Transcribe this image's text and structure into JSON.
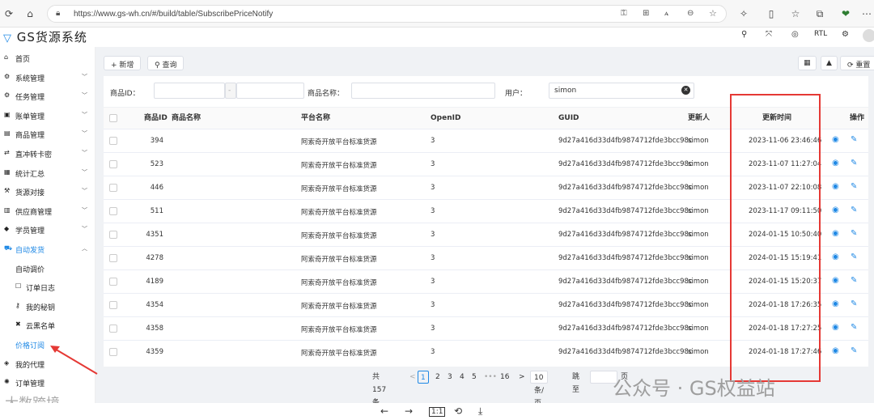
{
  "browser": {
    "url": "https://www.gs-wh.cn/#/build/table/SubscribePriceNotify"
  },
  "app": {
    "logo_text": "GS货源系统",
    "rtl_label": "RTL"
  },
  "sidebar": {
    "items": [
      {
        "label": "首页",
        "icon": "home-icon",
        "glyph": "⌂"
      },
      {
        "label": "系统管理",
        "icon": "gears-icon",
        "glyph": "⚙"
      },
      {
        "label": "任务管理",
        "icon": "gear-icon",
        "glyph": "⚙"
      },
      {
        "label": "账单管理",
        "icon": "money-icon",
        "glyph": "▣"
      },
      {
        "label": "商品管理",
        "icon": "box-icon",
        "glyph": "▤"
      },
      {
        "label": "直冲转卡密",
        "icon": "shuffle-icon",
        "glyph": "⇄"
      },
      {
        "label": "统计汇总",
        "icon": "chart-icon",
        "glyph": "▦"
      },
      {
        "label": "货源对接",
        "icon": "hammer-icon",
        "glyph": "⚒"
      },
      {
        "label": "供应商管理",
        "icon": "store-icon",
        "glyph": "▥"
      },
      {
        "label": "学员管理",
        "icon": "graduation-icon",
        "glyph": "◆"
      },
      {
        "label": "自动发货",
        "icon": "car-icon",
        "glyph": "⛟"
      }
    ],
    "subitems": [
      {
        "label": "自动调价",
        "glyph": ""
      },
      {
        "label": "订单日志",
        "glyph": "☐"
      },
      {
        "label": "我的秘钥",
        "glyph": "⚷"
      },
      {
        "label": "云黑名单",
        "glyph": "✖"
      },
      {
        "label": "价格订阅",
        "glyph": ""
      }
    ],
    "bottom_items": [
      {
        "label": "我的代理",
        "glyph": "◈"
      },
      {
        "label": "订单管理",
        "glyph": "✺"
      }
    ]
  },
  "toolbar": {
    "add_label": "新增",
    "search_label": "查询",
    "reset_label": "重置"
  },
  "filters": {
    "product_id_label": "商品ID：",
    "product_name_label": "商品名称：",
    "user_label": "用户：",
    "user_value": "simon",
    "range_sep": "-"
  },
  "table": {
    "headers": [
      "商品ID",
      "商品名称",
      "平台名称",
      "OpenID",
      "GUID",
      "更新人",
      "更新时间",
      "操作"
    ],
    "rows": [
      [
        "394",
        "",
        "阿索奇开放平台标准货源",
        "3",
        "9d27a416d33d4fb9874712fde3bcc98c",
        "simon",
        "2023-11-06 23:46:46"
      ],
      [
        "523",
        "",
        "阿索奇开放平台标准货源",
        "3",
        "9d27a416d33d4fb9874712fde3bcc98c",
        "simon",
        "2023-11-07 11:27:04"
      ],
      [
        "446",
        "",
        "阿索奇开放平台标准货源",
        "3",
        "9d27a416d33d4fb9874712fde3bcc98c",
        "simon",
        "2023-11-07 22:10:08"
      ],
      [
        "511",
        "",
        "阿索奇开放平台标准货源",
        "3",
        "9d27a416d33d4fb9874712fde3bcc98c",
        "simon",
        "2023-11-17 09:11:50"
      ],
      [
        "4351",
        "",
        "阿索奇开放平台标准货源",
        "3",
        "9d27a416d33d4fb9874712fde3bcc98c",
        "simon",
        "2024-01-15 10:50:40"
      ],
      [
        "4278",
        "",
        "阿索奇开放平台标准货源",
        "3",
        "9d27a416d33d4fb9874712fde3bcc98c",
        "simon",
        "2024-01-15 15:19:41"
      ],
      [
        "4189",
        "",
        "阿索奇开放平台标准货源",
        "3",
        "9d27a416d33d4fb9874712fde3bcc98c",
        "simon",
        "2024-01-15 15:20:37"
      ],
      [
        "4354",
        "",
        "阿索奇开放平台标准货源",
        "3",
        "9d27a416d33d4fb9874712fde3bcc98c",
        "simon",
        "2024-01-18 17:26:35"
      ],
      [
        "4358",
        "",
        "阿索奇开放平台标准货源",
        "3",
        "9d27a416d33d4fb9874712fde3bcc98c",
        "simon",
        "2024-01-18 17:27:25"
      ],
      [
        "4359",
        "",
        "阿索奇开放平台标准货源",
        "3",
        "9d27a416d33d4fb9874712fde3bcc98c",
        "simon",
        "2024-01-18 17:27:46"
      ]
    ]
  },
  "pagination": {
    "total": "共 157 条",
    "pages": [
      "1",
      "2",
      "3",
      "4",
      "5",
      "16"
    ],
    "ellipsis": "•••",
    "page_size": "10 条/页",
    "goto_label": "跳至",
    "page_unit": "页"
  },
  "watermark": {
    "text": "公众号 · GS权益站",
    "text2": "大数跨境"
  },
  "colors": {
    "accent": "#1e88e5",
    "highlight_box": "#e53935"
  }
}
